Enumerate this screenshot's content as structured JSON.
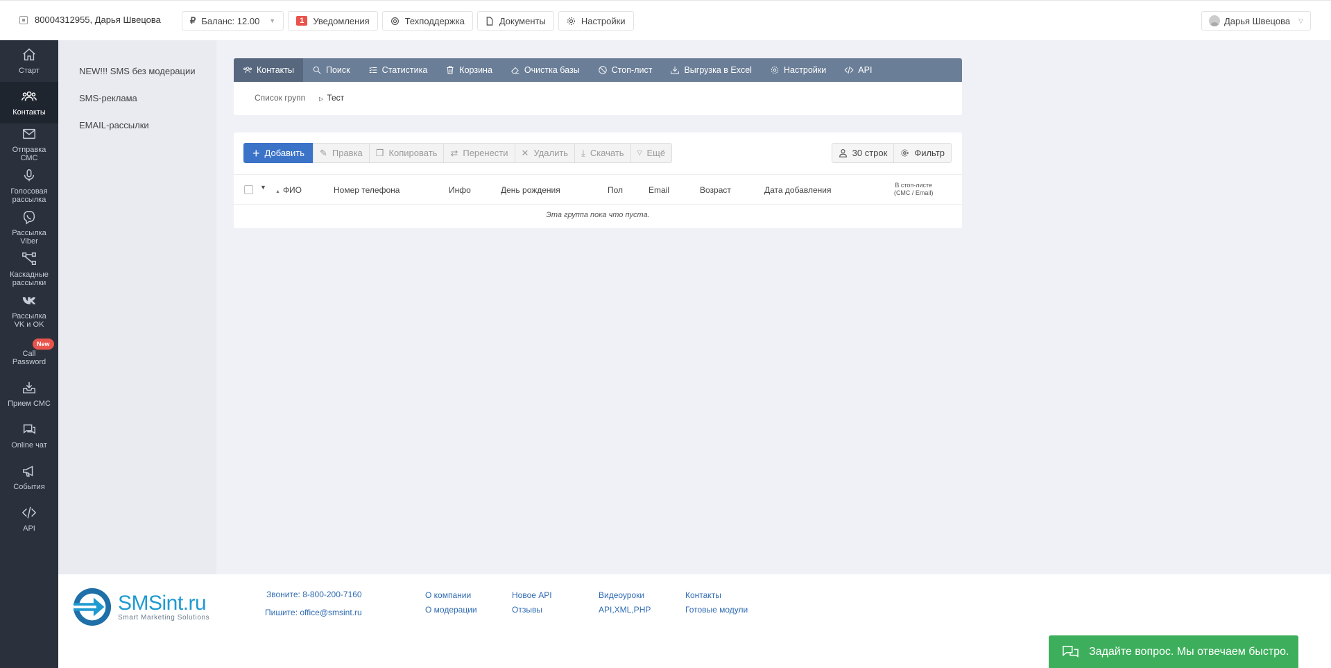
{
  "topbar": {
    "account": "80004312955, Дарья Швецова",
    "balance": "Баланс: 12.00",
    "notifications_count": "1",
    "notifications": "Уведомления",
    "support": "Техподдержка",
    "documents": "Документы",
    "settings": "Настройки",
    "user": "Дарья Швецова"
  },
  "leftnav": [
    {
      "label": "Старт",
      "icon": "home-icon"
    },
    {
      "label": "Контакты",
      "icon": "users-icon"
    },
    {
      "label": "Отправка СМС",
      "icon": "envelope-icon"
    },
    {
      "label": "Голосовая рассылка",
      "icon": "microphone-icon"
    },
    {
      "label": "Рассылка Viber",
      "icon": "viber-icon"
    },
    {
      "label": "Каскадные рассылки",
      "icon": "cascade-icon"
    },
    {
      "label": "Рассылка VK и OK",
      "icon": "vk-icon"
    },
    {
      "label": "Call Password",
      "icon": "call-icon",
      "badge": "New"
    },
    {
      "label": "Прием СМС",
      "icon": "inbox-icon"
    },
    {
      "label": "Online чат",
      "icon": "chat-icon"
    },
    {
      "label": "События",
      "icon": "megaphone-icon"
    },
    {
      "label": "API",
      "icon": "code-icon"
    }
  ],
  "subnav": [
    "NEW!!! SMS без модерации",
    "SMS-реклама",
    "EMAIL-рассылки"
  ],
  "tabs": [
    "Контакты",
    "Поиск",
    "Статистика",
    "Корзина",
    "Очистка базы",
    "Стоп-лист",
    "Выгрузка в Excel",
    "Настройки",
    "API"
  ],
  "breadcrumb": {
    "groups": "Список групп",
    "current": "Тест"
  },
  "toolbar": {
    "add": "Добавить",
    "edit": "Правка",
    "copy": "Копировать",
    "move": "Перенести",
    "delete": "Удалить",
    "download": "Скачать",
    "more": "Ещё",
    "rows": "30 строк",
    "filter": "Фильтр"
  },
  "table": {
    "columns": [
      "ФИО",
      "Номер телефона",
      "Инфо",
      "День рождения",
      "Пол",
      "Email",
      "Возраст",
      "Дата добавления"
    ],
    "stoplist_col_line1": "В стоп-листе",
    "stoplist_col_line2": "(СМС / Email)",
    "empty": "Эта группа пока что пуста."
  },
  "footer": {
    "logo_name": "SMSint.ru",
    "logo_tagline": "Smart Marketing Solutions",
    "call": "Звоните: 8-800-200-7160",
    "write": "Пишите: office@smsint.ru",
    "links": [
      "О компании",
      "О модерации",
      "Новое API",
      "Отзывы",
      "Видеоуроки",
      "API,XML,PHP",
      "Контакты",
      "Готовые модули"
    ]
  },
  "chat": "Задайте вопрос. Мы отвечаем быстро.",
  "colors": {
    "accent": "#3b73c8",
    "tabbar": "#6b7e97",
    "sidebar": "#2a313c",
    "chat": "#3daf5c",
    "badge": "#e8534c"
  }
}
